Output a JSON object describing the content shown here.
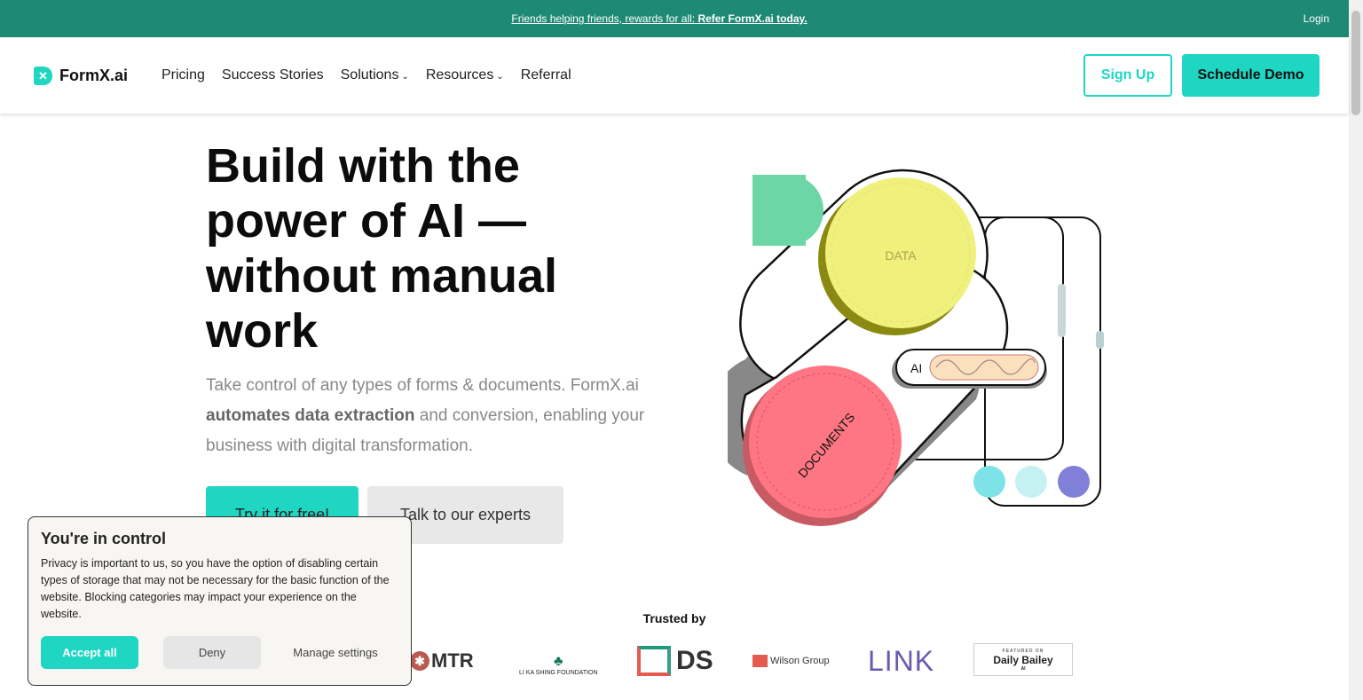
{
  "topbar": {
    "promo_prefix": "Friends helping friends, rewards for all: ",
    "promo_bold": "Refer FormX.ai today.",
    "login": "Login"
  },
  "nav": {
    "brand": "FormX.ai",
    "items": [
      "Pricing",
      "Success Stories",
      "Solutions",
      "Resources",
      "Referral"
    ],
    "signup": "Sign Up",
    "demo": "Schedule Demo"
  },
  "hero": {
    "headline": "Build with the power of AI — without manual work",
    "lede_1": "Take control of any types of forms & documents. FormX.ai ",
    "lede_bold": "automates data extraction",
    "lede_2": " and conversion, enabling your business with digital transformation.",
    "try": "Try it for free!",
    "talk": "Talk to our experts"
  },
  "illustration": {
    "data": "DATA",
    "ai": "AI",
    "documents": "DOCUMENTS"
  },
  "trusted": {
    "title": "Trusted by",
    "logos": [
      "MTR",
      "LI KA SHING FOUNDATION",
      "DS",
      "Wilson Group",
      "LINK",
      "FEATURED ON",
      "Daily Bailey",
      "AI"
    ]
  },
  "cookie": {
    "title": "You're in control",
    "body": "Privacy is important to us, so you have the option of disabling certain types of storage that may not be necessary for the basic function of the website. Blocking categories may impact your experience on the website.",
    "accept": "Accept all",
    "deny": "Deny",
    "manage": "Manage settings"
  },
  "colors": {
    "teal_bar": "#1e8a76",
    "accent": "#1fd6c3",
    "data": "#f0f17c",
    "documents": "#fe7683"
  }
}
